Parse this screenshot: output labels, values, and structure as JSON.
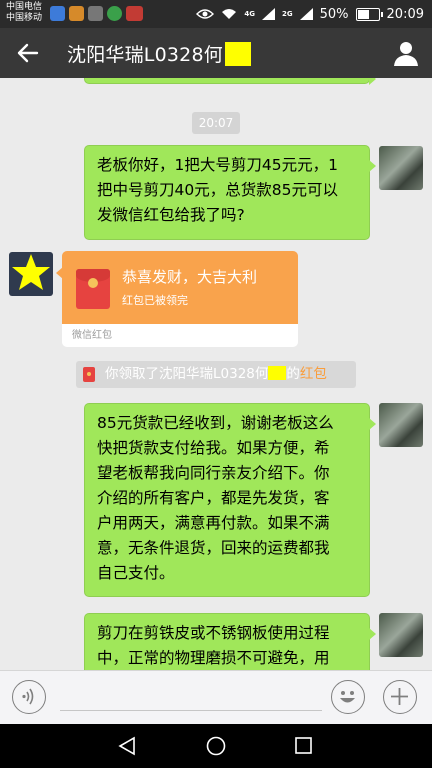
{
  "status_bar": {
    "carrier1": "中国电信",
    "carrier2": "中国移动",
    "network1": "4G",
    "network2": "2G",
    "battery": "50%",
    "battery_level": 0.5,
    "time": "20:09"
  },
  "header": {
    "title": "沈阳华瑞L0328何",
    "back_icon": "back-arrow-icon",
    "profile_icon": "person-icon"
  },
  "chat": {
    "timestamp": "20:07",
    "msg1": {
      "line1": "老板你好，1把大号剪刀45元元，1",
      "line2": "把中号剪刀40元，总货款85元可以",
      "line3": "发微信红包给我了吗?"
    },
    "red_packet": {
      "greeting": "恭喜发财，大吉大利",
      "status": "红包已被领完",
      "footer": "微信红包"
    },
    "notice": {
      "prefix": "你领取了沈阳华瑞L0328何",
      "middle": "的",
      "link": "红包"
    },
    "msg2": {
      "line1": "85元货款已经收到，谢谢老板这么",
      "line2": "快把货款支付给我。如果方便，希",
      "line3": "望老板帮我向同行亲友介绍下。你",
      "line4": "介绍的所有客户，都是先发货，客",
      "line5": "户用两天，满意再付款。如果不满",
      "line6": "意，无条件退货，回来的运费都我",
      "line7": "自己支付。"
    },
    "msg3": {
      "line1": "剪刀在剪铁皮或不锈钢板使用过程",
      "line2": "中，正常的物理磨损不可避免，用"
    }
  },
  "colors": {
    "bubble_green": "#a0e75a",
    "header_bg": "#383838",
    "red_packet_orange": "#f9a34c",
    "link_orange": "#fa9d3b"
  }
}
